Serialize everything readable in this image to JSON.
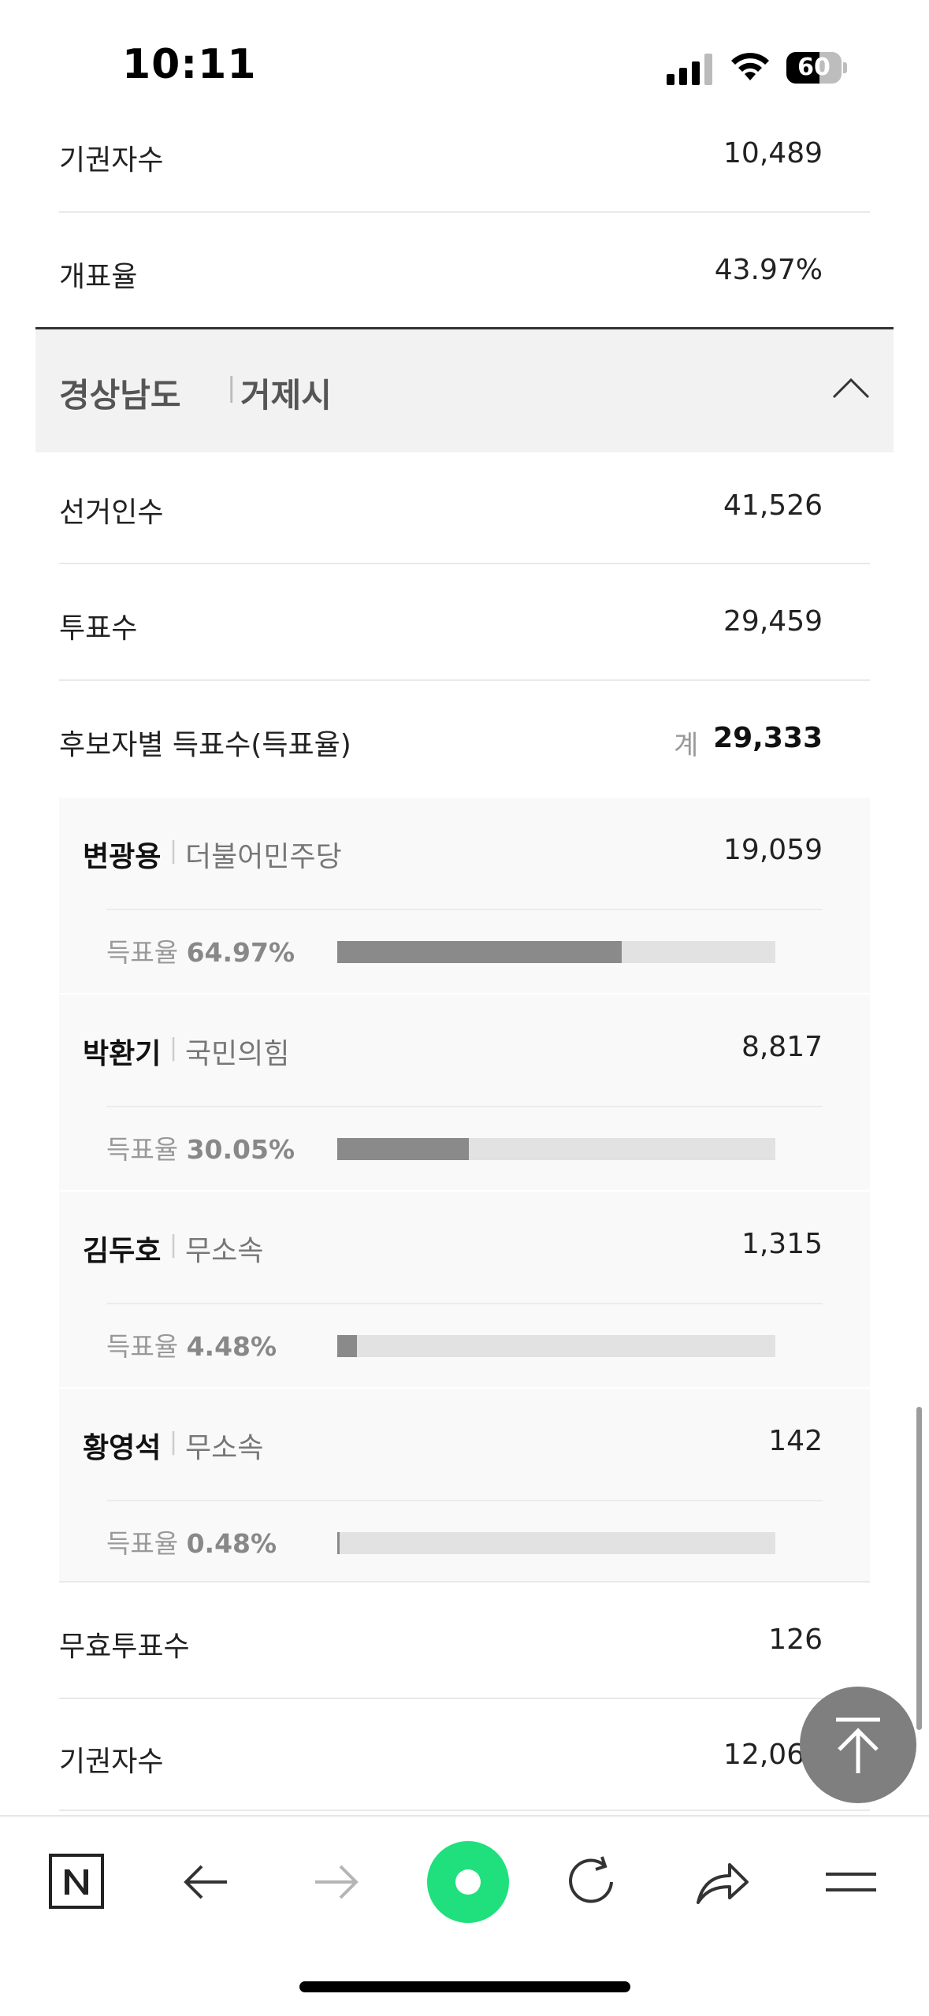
{
  "status": {
    "time": "10:11",
    "battery": "60",
    "battery_level": 0.6
  },
  "prev_summary": {
    "abstain_label": "기권자수",
    "abstain_value": "10,489",
    "count_rate_label": "개표율",
    "count_rate_value": "43.97%"
  },
  "region": {
    "province": "경상남도",
    "separator": "|",
    "city": "거제시"
  },
  "stats": {
    "electorate_label": "선거인수",
    "electorate_value": "41,526",
    "turnout_label": "투표수",
    "turnout_value": "29,459",
    "by_candidate_label": "후보자별 득표수(득표율)",
    "total_label": "계",
    "total_value": "29,333"
  },
  "rate_prefix": "득표율",
  "candidates": [
    {
      "name": "변광용",
      "party": "더불어민주당",
      "votes": "19,059",
      "rate": "64.97%",
      "share": 0.6497
    },
    {
      "name": "박환기",
      "party": "국민의힘",
      "votes": "8,817",
      "rate": "30.05%",
      "share": 0.3005
    },
    {
      "name": "김두호",
      "party": "무소속",
      "votes": "1,315",
      "rate": "4.48%",
      "share": 0.0448
    },
    {
      "name": "황영석",
      "party": "무소속",
      "votes": "142",
      "rate": "0.48%",
      "share": 0.0048
    }
  ],
  "footer_stats": {
    "invalid_label": "무효투표수",
    "invalid_value": "126",
    "abstain_label": "기권자수",
    "abstain_value": "12,067"
  },
  "toolbar": {
    "icons": [
      "naver-home-icon",
      "back-arrow-icon",
      "forward-arrow-icon",
      "green-dot-icon",
      "reload-icon",
      "share-icon",
      "menu-icon"
    ]
  },
  "colors": {
    "accent_green": "#1fe07d",
    "bar_fill": "#8a8a8a",
    "bar_track": "#e2e2e2"
  }
}
